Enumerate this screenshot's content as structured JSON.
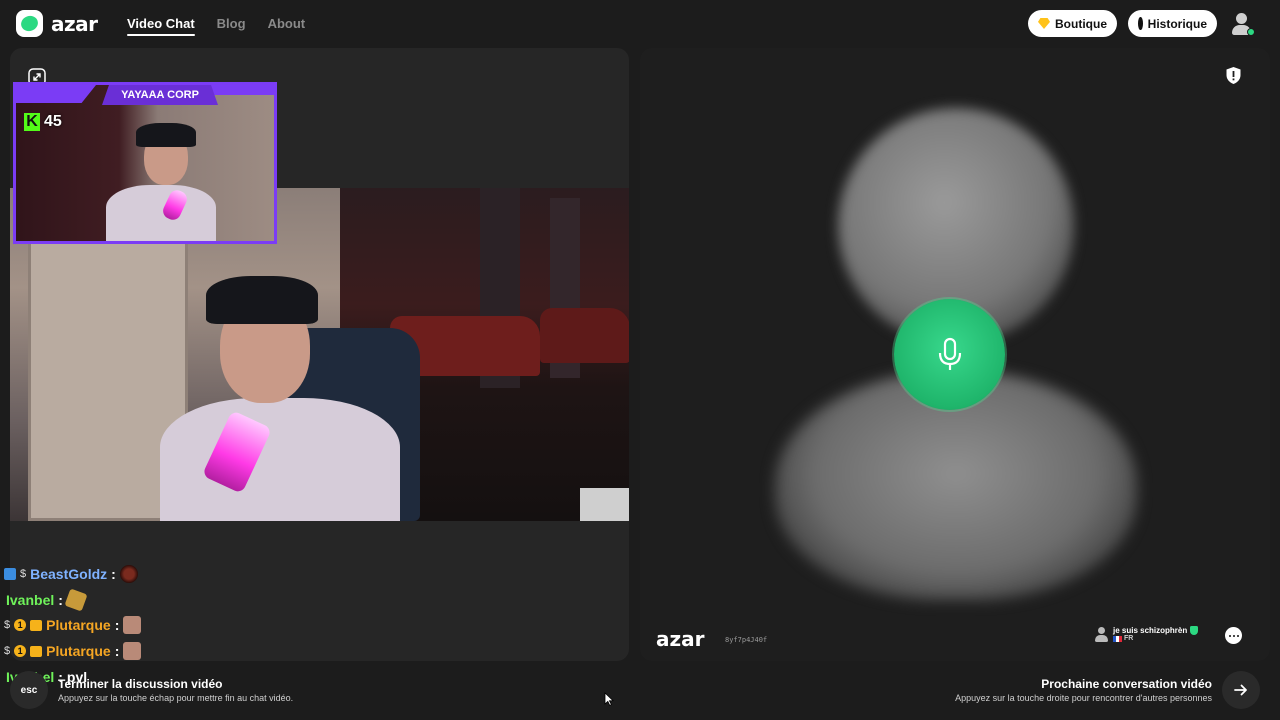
{
  "brand": {
    "logo_text": "azar"
  },
  "nav": {
    "items": [
      {
        "label": "Video Chat",
        "active": true
      },
      {
        "label": "Blog",
        "active": false
      },
      {
        "label": "About",
        "active": false
      }
    ]
  },
  "header_actions": {
    "shop_label": "Boutique",
    "history_label": "Historique",
    "shop_icon": "gem-icon",
    "history_icon": "clock-icon"
  },
  "my_video": {
    "overlay_title": "YAYAAA CORP",
    "kick_viewers": "45"
  },
  "stream_chat": [
    {
      "user": "BeastGoldz",
      "sep": ":",
      "badges": [
        "partner",
        "s"
      ],
      "user_color": "#7fb2ff"
    },
    {
      "user": "Ivanbel",
      "sep": ":",
      "badges": [],
      "user_color": "#6ff25a"
    },
    {
      "user": "Plutarque",
      "sep": ":",
      "badges": [
        "s",
        "coin-1",
        "crown"
      ],
      "user_color": "#f5a623"
    },
    {
      "user": "Plutarque",
      "sep": ":",
      "badges": [
        "s",
        "coin-1",
        "crown"
      ],
      "user_color": "#f5a623"
    },
    {
      "user": "Ivanbel",
      "sep": ":",
      "message": "pvl",
      "badges": [],
      "user_color": "#6ff25a"
    }
  ],
  "partner": {
    "watermark": "azar",
    "session_id": "8yf7p4J40f",
    "name": "je suis schizophrèn",
    "country": "FR",
    "mic_icon": "microphone-icon"
  },
  "footer": {
    "esc_key": "esc",
    "end_title": "Terminer la discussion vidéo",
    "end_hint": "Appuyez sur la touche échap pour mettre fin au chat vidéo.",
    "next_title": "Prochaine conversation vidéo",
    "next_hint": "Appuyez sur la touche droite pour rencontrer d'autres personnes"
  },
  "colors": {
    "accent_green": "#2cd982",
    "twitch_purple": "#7b3cf5",
    "kick_green": "#53fc18"
  }
}
